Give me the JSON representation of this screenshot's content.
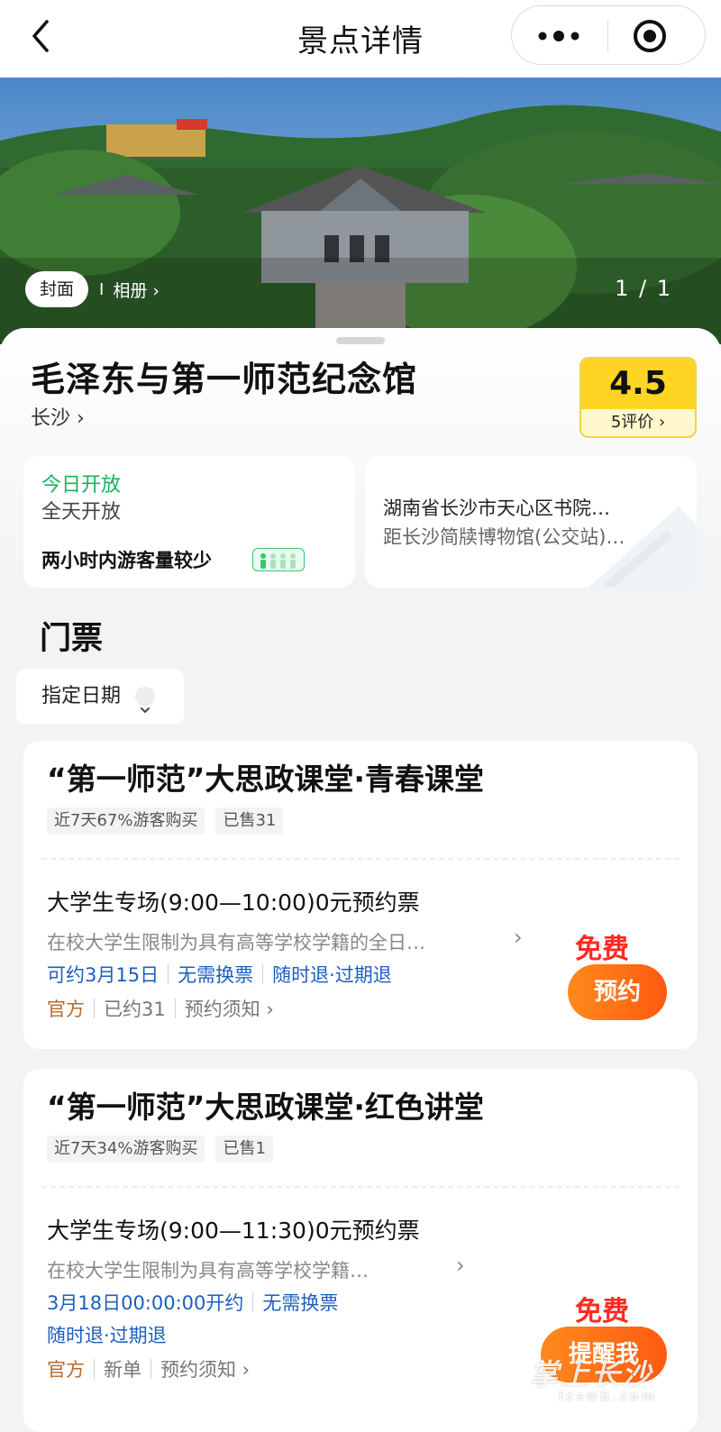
{
  "nav": {
    "title": "景点详情"
  },
  "hero": {
    "tab_cover": "封面",
    "tab_separator": "I",
    "tab_album": "相册",
    "tab_album_arrow": "›",
    "counter": "1 / 1"
  },
  "spot": {
    "name": "毛泽东与第一师范纪念馆",
    "city": "长沙 ›"
  },
  "rating": {
    "score": "4.5",
    "count": "5评价 ›",
    "color": "#ffd524"
  },
  "open_info": {
    "today": "今日开放",
    "hours": "全天开放",
    "crowd": "两小时内游客量较少",
    "status_color": "#17b35a"
  },
  "address": {
    "line": "湖南省长沙市天心区书院…",
    "distance": "距长沙简牍博物馆(公交站)…"
  },
  "tickets_section": {
    "title": "门票",
    "date_filter": "指定日期"
  },
  "products": [
    {
      "title": "“第一师范”大思政课堂·青春课堂",
      "tags": [
        "近7天67%游客购买",
        "已售31"
      ],
      "ticket": {
        "name": "大学生专场(9:00—10:00)0元预约票",
        "desc": "在校大学生限制为具有高等学校学籍的全日…",
        "rules": [
          "可约3月15日",
          "无需换票",
          "随时退·过期退"
        ],
        "official": "官方",
        "status": "已约31",
        "notice": "预约须知 ›",
        "price": "免费",
        "button": "预约"
      }
    },
    {
      "title": "“第一师范”大思政课堂·红色讲堂",
      "tags": [
        "近7天34%游客购买",
        "已售1"
      ],
      "ticket": {
        "name": "大学生专场(9:00—11:30)0元预约票",
        "desc": "在校大学生限制为具有高等学校学籍…",
        "rules": [
          "3月18日00:00:00开约",
          "无需换票",
          "随时退·过期退"
        ],
        "official": "官方",
        "status": "新单",
        "notice": "预约须知 ›",
        "price": "免费",
        "button": "提醒我"
      }
    }
  ],
  "watermark": {
    "name": "掌上长沙",
    "domain": "icswb.com"
  },
  "colors": {
    "accent_orange": "#ff6a14",
    "price_red": "#ff2a1f",
    "link_blue": "#1a5fbf",
    "official_brown": "#b96a2d"
  }
}
